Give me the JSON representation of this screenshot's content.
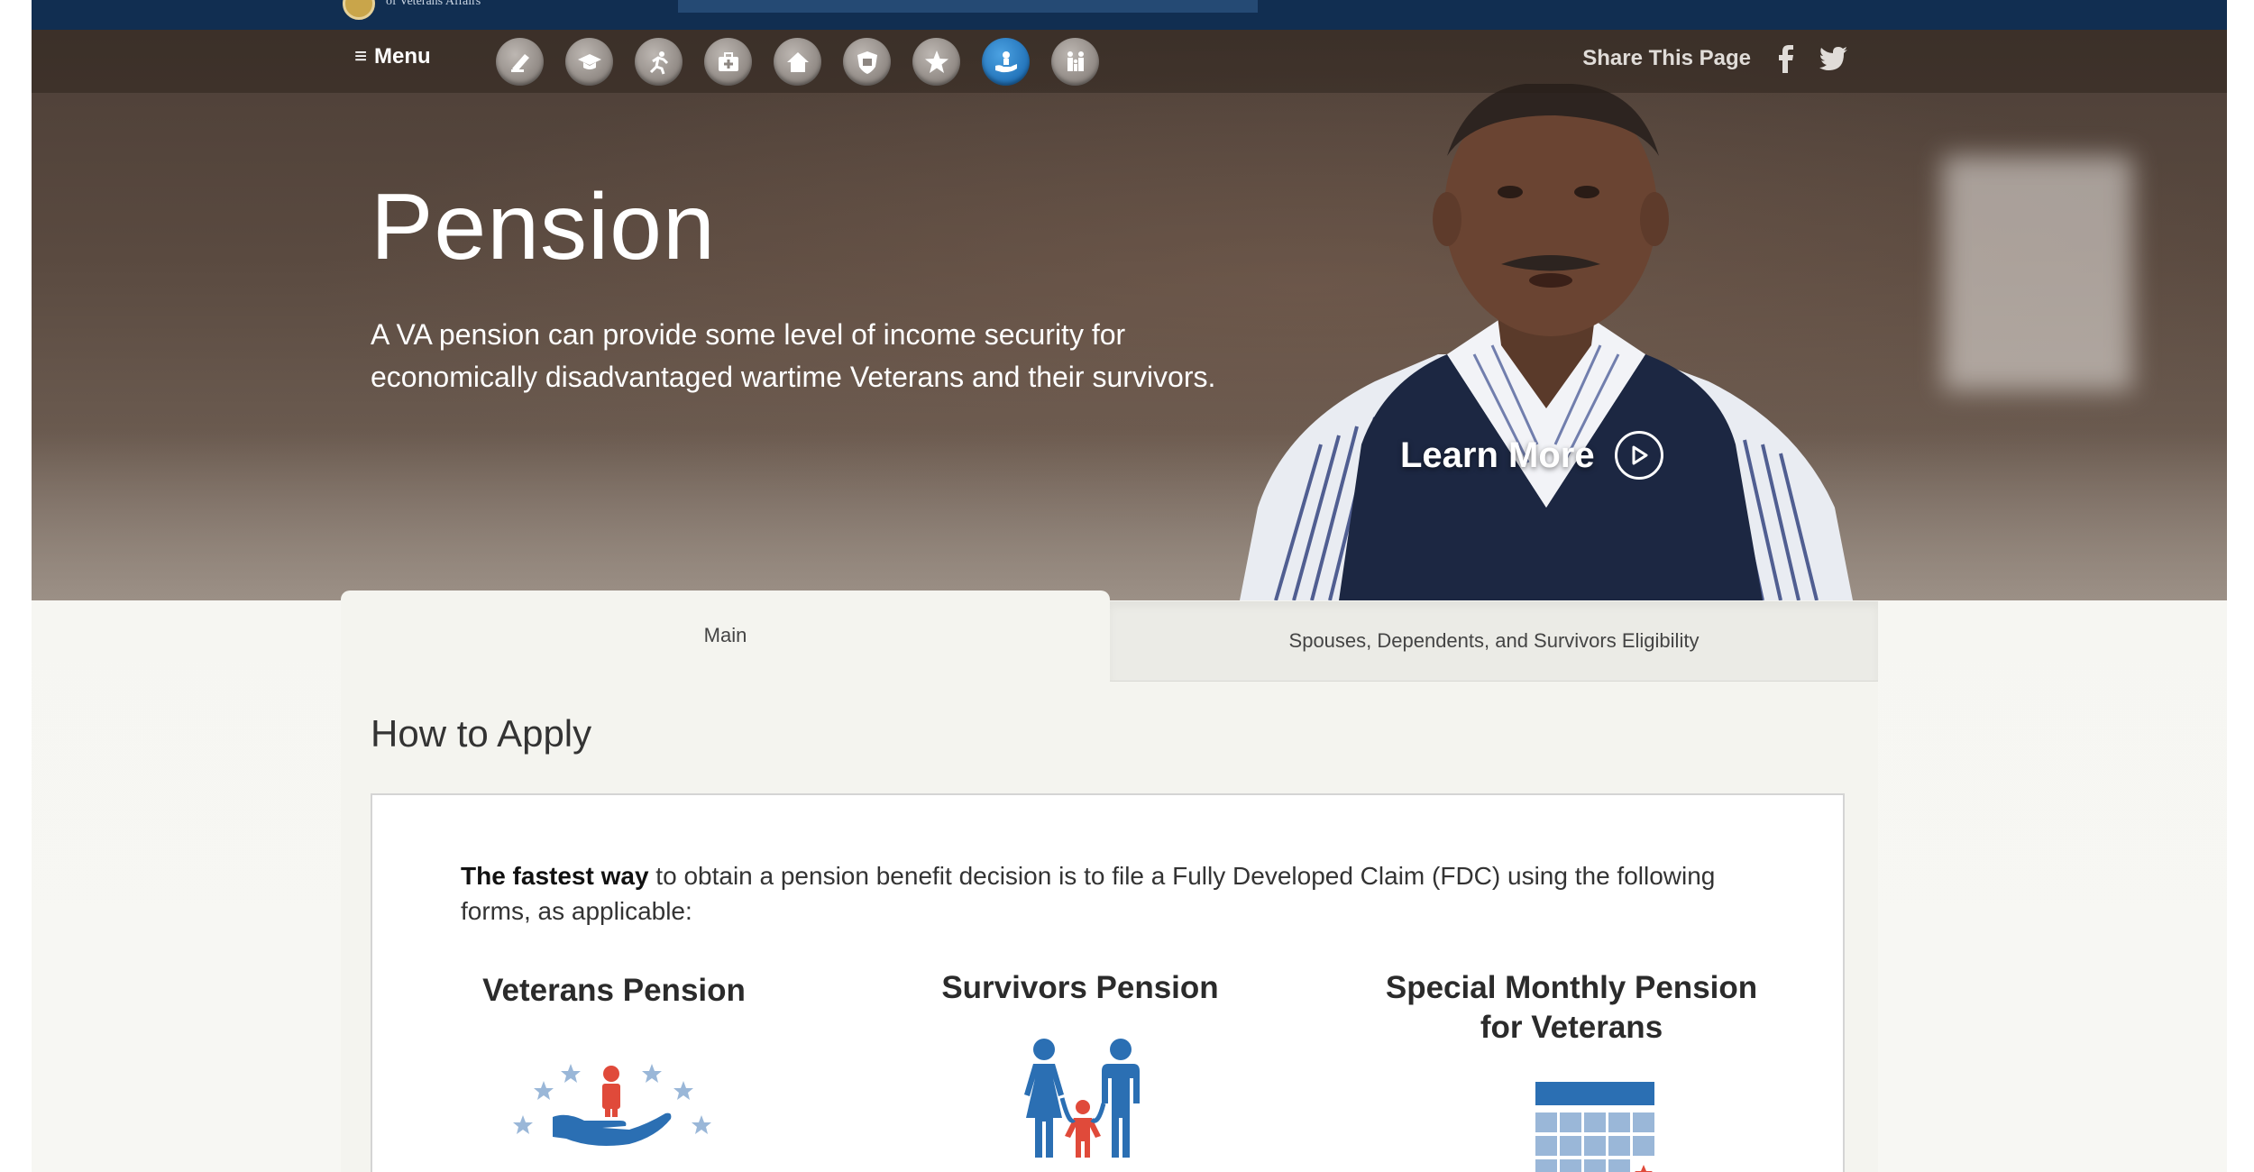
{
  "top_bar": {
    "org_name": "of Veterans Affairs"
  },
  "nav": {
    "menu_label": "Menu",
    "icons": [
      {
        "name": "disability-icon",
        "active": false
      },
      {
        "name": "education-icon",
        "active": false
      },
      {
        "name": "careers-icon",
        "active": false
      },
      {
        "name": "health-care-icon",
        "active": false
      },
      {
        "name": "housing-icon",
        "active": false
      },
      {
        "name": "life-insurance-icon",
        "active": false
      },
      {
        "name": "burials-memorials-icon",
        "active": false
      },
      {
        "name": "pension-icon",
        "active": true
      },
      {
        "name": "family-icon",
        "active": false
      }
    ],
    "share_label": "Share This Page",
    "social": [
      "facebook-icon",
      "twitter-icon"
    ]
  },
  "hero": {
    "title": "Pension",
    "description": "A VA pension can provide some level of income security for economically disadvantaged wartime Veterans and their survivors.",
    "learn_more": "Learn More"
  },
  "tabs": [
    {
      "label": "Main",
      "active": true
    },
    {
      "label": "Spouses, Dependents, and Survivors Eligibility",
      "active": false
    }
  ],
  "section": {
    "title": "How to Apply",
    "intro_bold": "The fastest way",
    "intro_rest": " to obtain a pension benefit decision is to file a Fully Developed Claim (FDC) using the following forms, as applicable:",
    "columns": [
      {
        "title": "Veterans Pension",
        "icon": "veteran-hand-stars-icon"
      },
      {
        "title": "Survivors Pension",
        "icon": "family-survivors-icon"
      },
      {
        "title": "Special Monthly Pension for Veterans",
        "icon": "calendar-icon"
      }
    ]
  },
  "colors": {
    "va_navy": "#112e51",
    "accent_blue": "#2b7cc2",
    "icon_blue": "#3a7bbf",
    "icon_red": "#e04a3a"
  }
}
